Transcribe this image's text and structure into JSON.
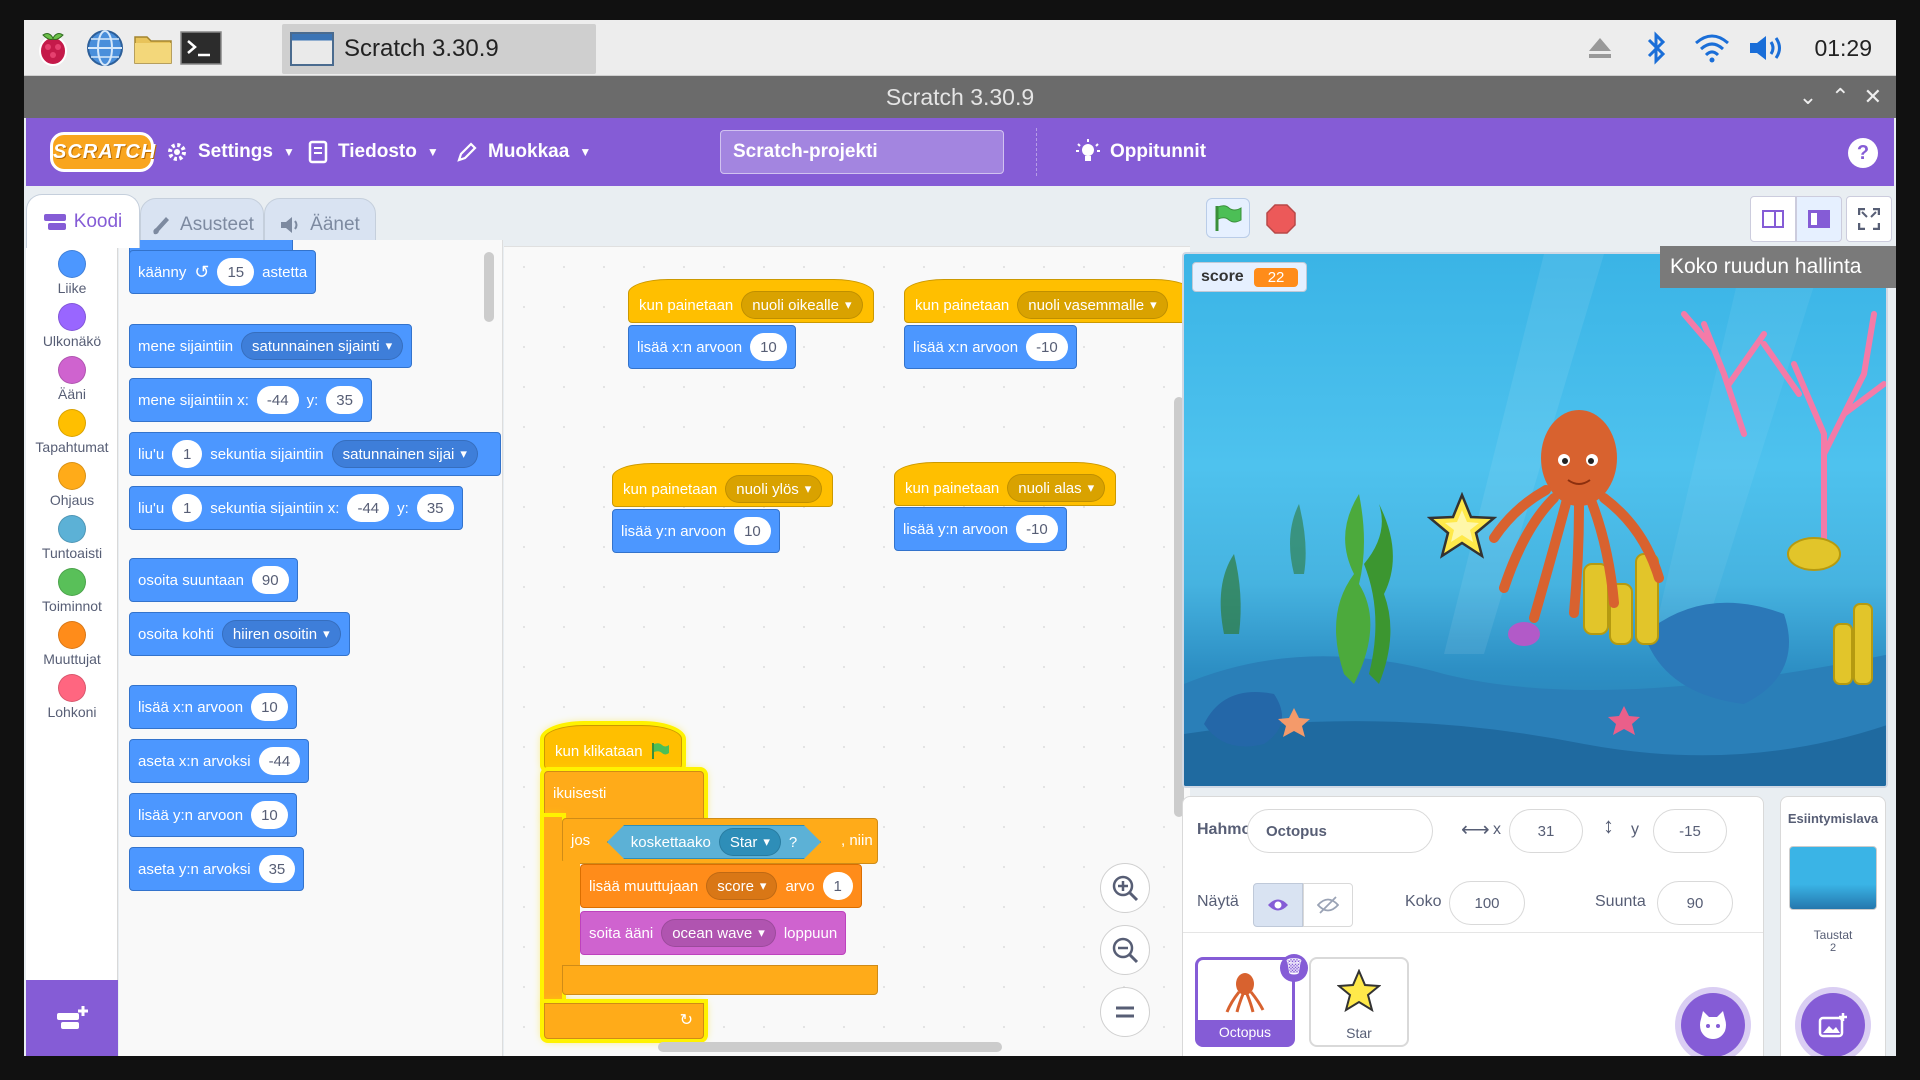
{
  "taskbar": {
    "app_title": "Scratch 3.30.9",
    "clock": "01:29"
  },
  "window": {
    "title": "Scratch 3.30.9"
  },
  "menubar": {
    "logo": "SCRATCH",
    "settings": "Settings",
    "file": "Tiedosto",
    "edit": "Muokkaa",
    "project_title": "Scratch-projekti",
    "tutorials": "Oppitunnit",
    "help": "?"
  },
  "tabs": {
    "code": "Koodi",
    "costumes": "Asusteet",
    "sounds": "Äänet"
  },
  "categories": [
    {
      "label": "Liike",
      "color": "#4c97ff"
    },
    {
      "label": "Ulkonäkö",
      "color": "#9966ff"
    },
    {
      "label": "Ääni",
      "color": "#cf63cf"
    },
    {
      "label": "Tapahtumat",
      "color": "#ffbf00"
    },
    {
      "label": "Ohjaus",
      "color": "#ffab19"
    },
    {
      "label": "Tuntoaisti",
      "color": "#5cb1d6"
    },
    {
      "label": "Toiminnot",
      "color": "#59c059"
    },
    {
      "label": "Muuttujat",
      "color": "#ff8c1a"
    },
    {
      "label": "Lohkoni",
      "color": "#ff6680"
    }
  ],
  "palette": {
    "turn": {
      "pre": "käänny",
      "val": "15",
      "post": "astetta"
    },
    "goto_random": {
      "pre": "mene sijaintiin",
      "drop": "satunnainen sijainti"
    },
    "goto_xy": {
      "pre": "mene sijaintiin x:",
      "x": "-44",
      "ylbl": "y:",
      "y": "35"
    },
    "glide_random": {
      "pre": "liu'u",
      "val": "1",
      "mid": "sekuntia sijaintiin",
      "drop": "satunnainen sijai"
    },
    "glide_xy": {
      "pre": "liu'u",
      "val": "1",
      "mid": "sekuntia sijaintiin x:",
      "x": "-44",
      "ylbl": "y:",
      "y": "35"
    },
    "point_dir": {
      "pre": "osoita suuntaan",
      "val": "90"
    },
    "point_towards": {
      "pre": "osoita kohti",
      "drop": "hiiren osoitin"
    },
    "change_x": {
      "pre": "lisää x:n arvoon",
      "val": "10"
    },
    "set_x": {
      "pre": "aseta x:n arvoksi",
      "val": "-44"
    },
    "change_y": {
      "pre": "lisää y:n arvoon",
      "val": "10"
    },
    "set_y": {
      "pre": "aseta y:n arvoksi",
      "val": "35"
    }
  },
  "scripts": {
    "s1": {
      "hat": "kun painetaan",
      "key": "nuoli oikealle",
      "body": "lisää x:n arvoon",
      "val": "10"
    },
    "s2": {
      "hat": "kun painetaan",
      "key": "nuoli vasemmalle",
      "body": "lisää x:n arvoon",
      "val": "-10"
    },
    "s3": {
      "hat": "kun painetaan",
      "key": "nuoli ylös",
      "body": "lisää y:n arvoon",
      "val": "10"
    },
    "s4": {
      "hat": "kun painetaan",
      "key": "nuoli alas",
      "body": "lisää y:n arvoon",
      "val": "-10"
    },
    "main": {
      "hat": "kun klikataan",
      "forever": "ikuisesti",
      "if": "jos",
      "touching": "koskettaako",
      "touching_target": "Star",
      "touching_q": "?",
      "then": ", niin",
      "change_var": "lisää muuttujaan",
      "var": "score",
      "by": "arvo",
      "amount": "1",
      "play_sound": "soita ääni",
      "sound": "ocean wave",
      "until_done": "loppuun"
    }
  },
  "stage": {
    "monitor_label": "score",
    "monitor_value": "22",
    "tooltip": "Koko ruudun hallinta"
  },
  "sprite_info": {
    "sprite_label": "Hahmo",
    "sprite_name": "Octopus",
    "x_label": "x",
    "x": "31",
    "y_label": "y",
    "y": "-15",
    "show_label": "Näytä",
    "size_label": "Koko",
    "size": "100",
    "direction_label": "Suunta",
    "direction": "90"
  },
  "sprites": [
    {
      "name": "Octopus",
      "selected": true
    },
    {
      "name": "Star",
      "selected": false
    }
  ],
  "stage_pane": {
    "title": "Esiintymislava",
    "backdrops_label": "Taustat",
    "backdrops_count": "2"
  }
}
